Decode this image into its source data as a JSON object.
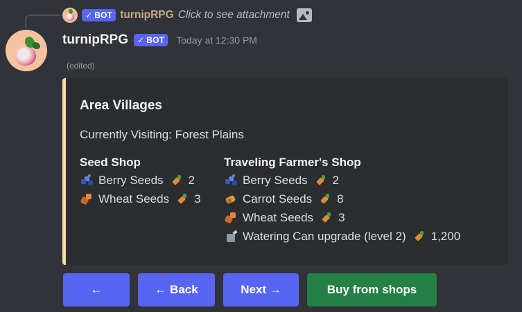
{
  "reply": {
    "bot_tag": "BOT",
    "author": "turnipRPG",
    "text": "Click to see attachment"
  },
  "message": {
    "author": "turnipRPG",
    "bot_tag": "BOT",
    "timestamp": "Today at 12:30 PM",
    "edited": "(edited)"
  },
  "embed": {
    "accent_color": "#f9dcab",
    "title": "Area Villages",
    "description": "Currently Visiting: Forest Plains",
    "fields": {
      "seed_shop": {
        "name": "Seed Shop",
        "items": [
          {
            "icon": "berry-seeds-icon",
            "name": "Berry Seeds",
            "price": "2"
          },
          {
            "icon": "wheat-seeds-icon",
            "name": "Wheat Seeds",
            "price": "3"
          }
        ]
      },
      "traveling_shop": {
        "name": "Traveling Farmer's Shop",
        "items": [
          {
            "icon": "berry-seeds-icon",
            "name": "Berry Seeds",
            "price": "2"
          },
          {
            "icon": "carrot-seeds-icon",
            "name": "Carrot Seeds",
            "price": "8"
          },
          {
            "icon": "wheat-seeds-icon",
            "name": "Wheat Seeds",
            "price": "3"
          },
          {
            "icon": "watering-can-icon",
            "name": "Watering Can upgrade (level 2)",
            "price": "1,200"
          }
        ]
      }
    }
  },
  "buttons": {
    "first": "←",
    "back": "← Back",
    "next": "Next →",
    "buy": "Buy from shops"
  },
  "colors": {
    "background": "#313338",
    "embed_bg": "#2b2d31",
    "blurple": "#5865f2",
    "green": "#248046"
  }
}
